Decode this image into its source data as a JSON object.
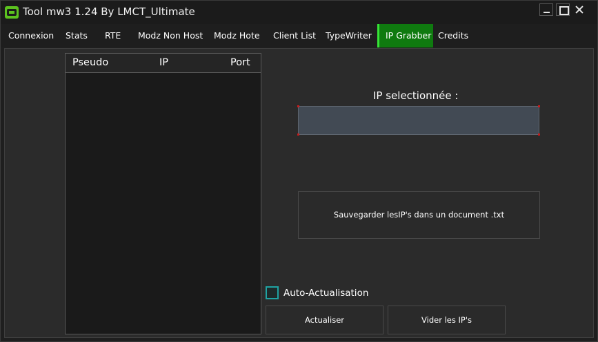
{
  "window": {
    "title": "Tool mw3 1.24 By LMCT_Ultimate",
    "icon": "controller-icon"
  },
  "tabs": [
    {
      "label": "Connexion",
      "active": false
    },
    {
      "label": "Stats",
      "active": false
    },
    {
      "label": "RTE",
      "active": false
    },
    {
      "label": "Modz Non Host",
      "active": false
    },
    {
      "label": "Modz Hote",
      "active": false
    },
    {
      "label": "Client List",
      "active": false
    },
    {
      "label": "TypeWriter",
      "active": false
    },
    {
      "label": "IP Grabber",
      "active": true
    },
    {
      "label": "Credits",
      "active": false
    }
  ],
  "list": {
    "columns": [
      "Pseudo",
      "IP",
      "Port"
    ],
    "rows": []
  },
  "ip_field": {
    "label": "IP selectionnée :",
    "value": ""
  },
  "buttons": {
    "save": "Sauvegarder lesIP's dans un document .txt",
    "refresh": "Actualiser",
    "clear": "Vider les IP's"
  },
  "auto_refresh": {
    "label": "Auto-Actualisation",
    "checked": false
  },
  "colors": {
    "active_tab": "#0f7a0f",
    "active_tab_accent": "#36e336",
    "checkbox_border": "#1fa3a3",
    "ip_field_bg": "#424a54"
  }
}
